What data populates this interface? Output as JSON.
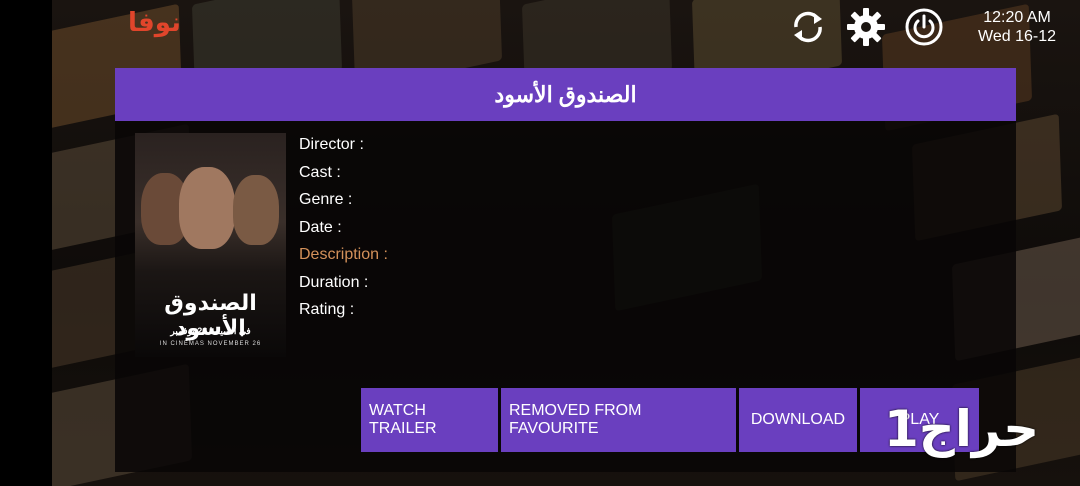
{
  "app": {
    "logo_text": "نوفا",
    "logo_color": "#e0452b"
  },
  "topbar": {
    "icons": [
      "refresh-icon",
      "gear-icon",
      "power-icon"
    ],
    "time": "12:20 AM",
    "date": "Wed 16-12"
  },
  "movie": {
    "title": "الصندوق الأسود",
    "poster": {
      "title": "الصندوق الأسود",
      "subtitle_ar": "في السينما 26 نوفمبر",
      "subtitle_en": "IN CINEMAS NOVEMBER 26"
    },
    "fields": {
      "director": "Director :",
      "cast": "Cast :",
      "genre": "Genre :",
      "date": "Date :",
      "description": "Description :",
      "duration": "Duration :",
      "rating": "Rating :"
    }
  },
  "actions": {
    "watch_trailer": "WATCH TRAILER",
    "favourite": "REMOVED FROM FAVOURITE",
    "download": "DOWNLOAD",
    "play": "PLAY"
  },
  "watermark": "حراج1",
  "colors": {
    "accent": "#6a3fbf",
    "description_label": "#d4915a"
  }
}
